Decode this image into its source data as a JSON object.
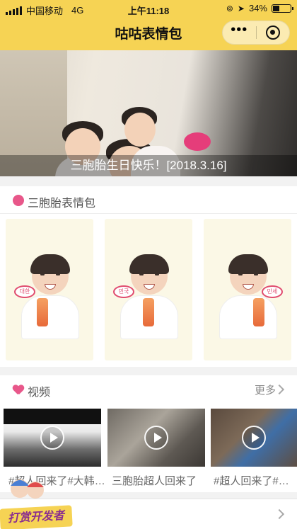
{
  "status_bar": {
    "carrier": "中国移动",
    "network": "4G",
    "time": "上午11:18",
    "battery": "34%",
    "battery_level": 0.34
  },
  "nav": {
    "title": "咕咕表情包",
    "menu_icon": "more-dots-icon",
    "close_icon": "target-circle-icon"
  },
  "banner": {
    "caption": "三胞胎生日快乐！[2018.3.16]"
  },
  "sticker_section": {
    "title": "三胞胎表情包",
    "icon": "pink-dot-icon",
    "cards": [
      {
        "tag": "대한"
      },
      {
        "tag": "민국"
      },
      {
        "tag": "만세"
      }
    ]
  },
  "video_section": {
    "title": "视频",
    "icon": "heart-icon",
    "more_label": "更多",
    "videos": [
      {
        "title": "#超人回来了#大韩民国万岁"
      },
      {
        "title": "三胞胎超人回来了"
      },
      {
        "title": "#超人回来了#《三胞胎》"
      }
    ]
  },
  "footer": {
    "badge": "打赏开发者"
  },
  "colors": {
    "accent": "#f6d354",
    "pink": "#e8578a"
  }
}
